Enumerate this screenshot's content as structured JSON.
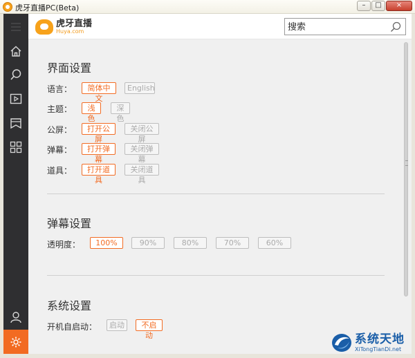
{
  "window": {
    "title": "虎牙直播PC(Beta)",
    "minimize_glyph": "–",
    "maximize_glyph": "□",
    "close_glyph": "×"
  },
  "logo": {
    "cn": "虎牙直播",
    "en": "Huya.com"
  },
  "search": {
    "placeholder": "搜索",
    "icon": "search-icon"
  },
  "sidebar": {
    "items": [
      {
        "name": "menu",
        "icon": "hamburger-icon"
      },
      {
        "name": "home",
        "icon": "home-icon"
      },
      {
        "name": "search",
        "icon": "search-icon"
      },
      {
        "name": "video",
        "icon": "play-icon"
      },
      {
        "name": "subscriptions",
        "icon": "bookmark-icon"
      },
      {
        "name": "categories",
        "icon": "grid-icon"
      },
      {
        "name": "user",
        "icon": "user-icon"
      },
      {
        "name": "settings",
        "icon": "gear-icon"
      }
    ]
  },
  "interface_settings": {
    "title": "界面设置",
    "language": {
      "label": "语言：",
      "options": [
        "简体中文",
        "English"
      ],
      "selected": 0
    },
    "theme": {
      "label": "主题：",
      "options": [
        "浅色",
        "深色"
      ],
      "selected": 0
    },
    "public_screen": {
      "label": "公屏：",
      "options": [
        "打开公屏",
        "关闭公屏"
      ],
      "selected": 0
    },
    "danmaku": {
      "label": "弹幕：",
      "options": [
        "打开弹幕",
        "关闭弹幕"
      ],
      "selected": 0
    },
    "props": {
      "label": "道具：",
      "options": [
        "打开道具",
        "关闭道具"
      ],
      "selected": 0
    }
  },
  "danmaku_settings": {
    "title": "弹幕设置",
    "opacity": {
      "label": "透明度：",
      "options": [
        "100%",
        "90%",
        "80%",
        "70%",
        "60%"
      ],
      "selected": 0
    }
  },
  "system_settings": {
    "title": "系统设置",
    "autostart": {
      "label": "开机自启动：",
      "options": [
        "启动",
        "不启动"
      ],
      "selected": 1
    }
  },
  "watermark": {
    "cn": "系统天地",
    "en": "XiTongTianDi.net"
  },
  "colors": {
    "accent": "#f26b22",
    "sidebar_bg": "#2f2f31",
    "content_bg": "#f0f0f0"
  }
}
